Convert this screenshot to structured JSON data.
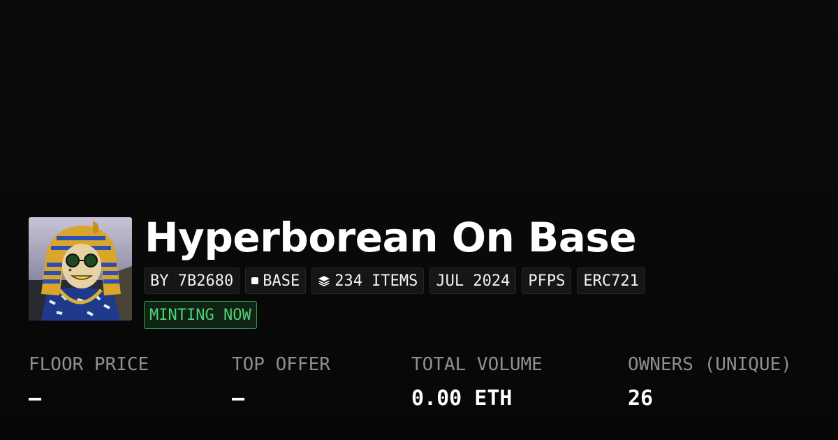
{
  "collection": {
    "title": "Hyperborean On Base",
    "avatar": "pharaoh-pfp-artwork"
  },
  "chips": {
    "creator": "BY 7B2680",
    "chain": "BASE",
    "chain_icon": "square-chain-icon",
    "items": "234 ITEMS",
    "items_icon": "layers-icon",
    "date": "JUL 2024",
    "category": "PFPS",
    "standard": "ERC721"
  },
  "status": {
    "label": "MINTING NOW",
    "color": "#4fd076"
  },
  "stats": [
    {
      "label": "FLOOR PRICE",
      "value": "–"
    },
    {
      "label": "TOP OFFER",
      "value": "–"
    },
    {
      "label": "TOTAL VOLUME",
      "value": "0.00 ETH"
    },
    {
      "label": "OWNERS (UNIQUE)",
      "value": "26"
    }
  ]
}
